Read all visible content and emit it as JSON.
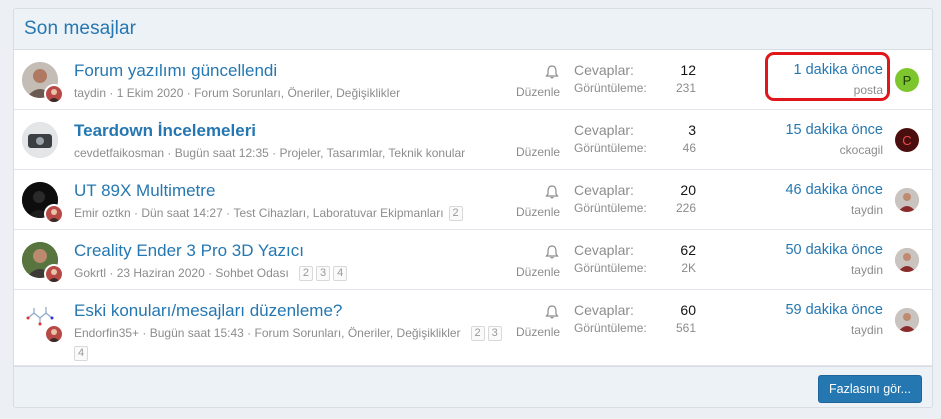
{
  "header": {
    "title": "Son mesajlar"
  },
  "threads": [
    {
      "title": "Forum yazılımı güncellendi",
      "bold": false,
      "author": "taydin",
      "date": "1 Ekim 2020",
      "forum": "Forum Sorunları, Öneriler, Değişiklikler",
      "pages": [],
      "watch": true,
      "edit": "Düzenle",
      "replies_label": "Cevaplar:",
      "replies": "12",
      "views_label": "Görüntüleme:",
      "views": "231",
      "last_time": "1 dakika önce",
      "last_user": "posta",
      "last_avatar_letter": "P",
      "last_avatar_color": "#7dc62d"
    },
    {
      "title": "Teardown İncelemeleri",
      "bold": true,
      "author": "cevdetfaikosman",
      "date": "Bugün saat 12:35",
      "forum": "Projeler, Tasarımlar, Teknik konular",
      "pages": [],
      "watch": false,
      "edit": "Düzenle",
      "replies_label": "Cevaplar:",
      "replies": "3",
      "views_label": "Görüntüleme:",
      "views": "46",
      "last_time": "15 dakika önce",
      "last_user": "ckocagil",
      "last_avatar_letter": "C",
      "last_avatar_color": "#4a0e0e"
    },
    {
      "title": "UT 89X Multimetre",
      "bold": false,
      "author": "Emir oztkn",
      "date": "Dün saat 14:27",
      "forum": "Test Cihazları, Laboratuvar Ekipmanları",
      "pages": [
        "2"
      ],
      "watch": true,
      "edit": "Düzenle",
      "replies_label": "Cevaplar:",
      "replies": "20",
      "views_label": "Görüntüleme:",
      "views": "226",
      "last_time": "46 dakika önce",
      "last_user": "taydin",
      "last_avatar_letter": "",
      "last_avatar_color": "#9a7a6a"
    },
    {
      "title": "Creality Ender 3 Pro 3D Yazıcı",
      "bold": false,
      "author": "Gokrtl",
      "date": "23 Haziran 2020",
      "forum": "Sohbet Odası",
      "pages": [
        "2",
        "3",
        "4"
      ],
      "watch": true,
      "edit": "Düzenle",
      "replies_label": "Cevaplar:",
      "replies": "62",
      "views_label": "Görüntüleme:",
      "views": "2K",
      "last_time": "50 dakika önce",
      "last_user": "taydin",
      "last_avatar_letter": "",
      "last_avatar_color": "#9a7a6a"
    },
    {
      "title": "Eski konuları/mesajları düzenleme?",
      "bold": false,
      "author": "Endorfin35+",
      "date": "Bugün saat 15:43",
      "forum": "Forum Sorunları, Öneriler, Değişiklikler",
      "pages": [
        "2",
        "3",
        "4"
      ],
      "watch": true,
      "edit": "Düzenle",
      "replies_label": "Cevaplar:",
      "replies": "60",
      "views_label": "Görüntüleme:",
      "views": "561",
      "last_time": "59 dakika önce",
      "last_user": "taydin",
      "last_avatar_letter": "",
      "last_avatar_color": "#9a7a6a"
    }
  ],
  "footer": {
    "more_label": "Fazlasını gör..."
  },
  "colors": {
    "link": "#2577b1",
    "button": "#2577b1",
    "highlight": "#e0161a"
  }
}
